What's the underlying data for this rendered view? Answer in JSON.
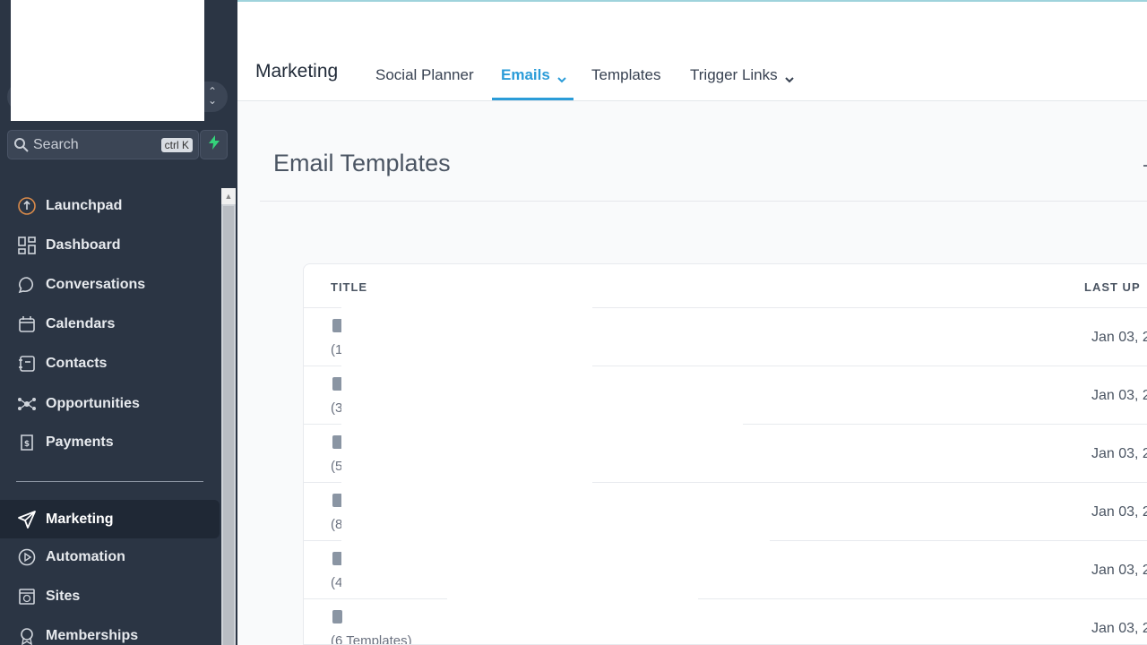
{
  "sidebar": {
    "search": {
      "placeholder": "Search",
      "shortcut": "ctrl K"
    },
    "items": [
      {
        "label": "Launchpad",
        "icon": "launchpad-icon"
      },
      {
        "label": "Dashboard",
        "icon": "dashboard-icon"
      },
      {
        "label": "Conversations",
        "icon": "chat-bubble-icon"
      },
      {
        "label": "Calendars",
        "icon": "calendar-icon"
      },
      {
        "label": "Contacts",
        "icon": "contacts-icon"
      },
      {
        "label": "Opportunities",
        "icon": "opportunities-icon"
      },
      {
        "label": "Payments",
        "icon": "payments-icon"
      },
      {
        "label": "Marketing",
        "icon": "paper-plane-icon",
        "active": true
      },
      {
        "label": "Automation",
        "icon": "automation-icon"
      },
      {
        "label": "Sites",
        "icon": "sites-icon"
      },
      {
        "label": "Memberships",
        "icon": "memberships-icon"
      }
    ]
  },
  "topbar": {
    "brand": "Marketing",
    "tabs": [
      {
        "label": "Social Planner"
      },
      {
        "label": "Emails",
        "active": true,
        "has_caret": true
      },
      {
        "label": "Templates"
      },
      {
        "label": "Trigger Links",
        "has_caret": true
      }
    ]
  },
  "page": {
    "title": "Email Templates",
    "accent_color": "#2b9cd8"
  },
  "table": {
    "columns": [
      "TITLE",
      "LAST UP"
    ],
    "rows": [
      {
        "count": "(1",
        "date": "Jan 03, 2"
      },
      {
        "count": "(3",
        "date": "Jan 03, 2"
      },
      {
        "count": "(5",
        "date": "Jan 03, 2"
      },
      {
        "count": "(8",
        "date": "Jan 03, 2"
      },
      {
        "count": "(4",
        "date": "Jan 03, 2"
      },
      {
        "count": "(6 Templates)",
        "date": "Jan 03, 2"
      }
    ]
  }
}
